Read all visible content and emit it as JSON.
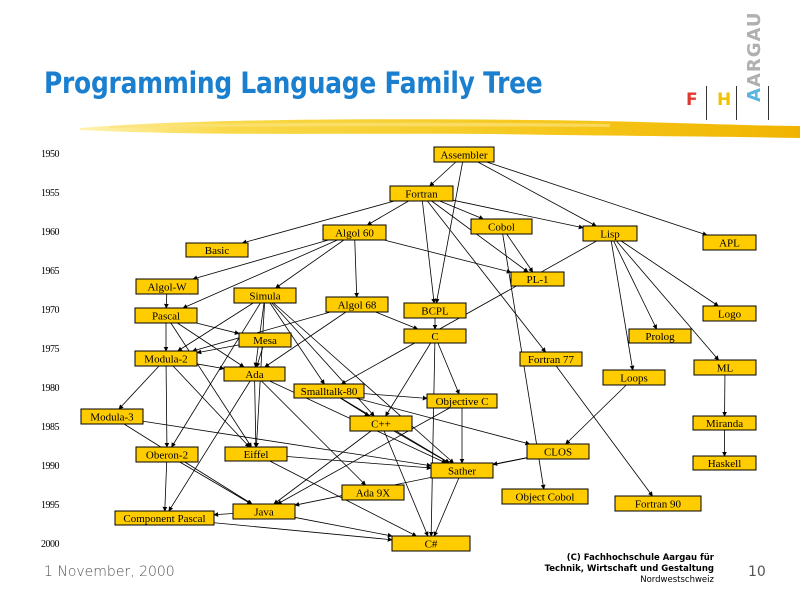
{
  "header": {
    "title": "Programming Language Family Tree",
    "logo": {
      "f": "F",
      "h": "H",
      "a_first": "A",
      "a_rest": "ARGAU"
    }
  },
  "colors": {
    "title": "#1a7fcf",
    "node_fill": "#ffcc00",
    "logo_f": "#e03a30",
    "logo_h": "#f2c200",
    "logo_a": "#5ab4e0"
  },
  "timeline": {
    "years": [
      "1950",
      "1955",
      "1960",
      "1965",
      "1970",
      "1975",
      "1980",
      "1985",
      "1990",
      "1995",
      "2000"
    ]
  },
  "diagram": {
    "nodes": [
      {
        "id": "assembler",
        "label": "Assembler"
      },
      {
        "id": "fortran",
        "label": "Fortran"
      },
      {
        "id": "cobol",
        "label": "Cobol"
      },
      {
        "id": "algol60",
        "label": "Algol 60"
      },
      {
        "id": "lisp",
        "label": "Lisp"
      },
      {
        "id": "apl",
        "label": "APL"
      },
      {
        "id": "basic",
        "label": "Basic"
      },
      {
        "id": "pl1",
        "label": "PL-1"
      },
      {
        "id": "algolw",
        "label": "Algol-W"
      },
      {
        "id": "simula",
        "label": "Simula"
      },
      {
        "id": "algol68",
        "label": "Algol 68"
      },
      {
        "id": "pascal",
        "label": "Pascal"
      },
      {
        "id": "bcpl",
        "label": "BCPL"
      },
      {
        "id": "logo",
        "label": "Logo"
      },
      {
        "id": "mesa",
        "label": "Mesa"
      },
      {
        "id": "c",
        "label": "C"
      },
      {
        "id": "prolog",
        "label": "Prolog"
      },
      {
        "id": "modula2",
        "label": "Modula-2"
      },
      {
        "id": "fortran77",
        "label": "Fortran 77"
      },
      {
        "id": "ml",
        "label": "ML"
      },
      {
        "id": "ada",
        "label": "Ada"
      },
      {
        "id": "loops",
        "label": "Loops"
      },
      {
        "id": "smalltalk80",
        "label": "Smalltalk-80"
      },
      {
        "id": "objc",
        "label": "Objective C"
      },
      {
        "id": "modula3",
        "label": "Modula-3"
      },
      {
        "id": "cpp",
        "label": "C++"
      },
      {
        "id": "miranda",
        "label": "Miranda"
      },
      {
        "id": "clos",
        "label": "CLOS"
      },
      {
        "id": "oberon2",
        "label": "Oberon-2"
      },
      {
        "id": "eiffel",
        "label": "Eiffel"
      },
      {
        "id": "haskell",
        "label": "Haskell"
      },
      {
        "id": "sather",
        "label": "Sather"
      },
      {
        "id": "ada9x",
        "label": "Ada 9X"
      },
      {
        "id": "objcobol",
        "label": "Object Cobol"
      },
      {
        "id": "fortran90",
        "label": "Fortran 90"
      },
      {
        "id": "java",
        "label": "Java"
      },
      {
        "id": "cpascal",
        "label": "Component Pascal"
      },
      {
        "id": "csharp",
        "label": "C#"
      }
    ],
    "edges": [
      [
        "assembler",
        "fortran"
      ],
      [
        "assembler",
        "bcpl"
      ],
      [
        "assembler",
        "lisp"
      ],
      [
        "assembler",
        "apl"
      ],
      [
        "fortran",
        "algol60"
      ],
      [
        "fortran",
        "cobol"
      ],
      [
        "fortran",
        "lisp"
      ],
      [
        "fortran",
        "basic"
      ],
      [
        "fortran",
        "pl1"
      ],
      [
        "fortran",
        "bcpl"
      ],
      [
        "fortran",
        "fortran77"
      ],
      [
        "cobol",
        "pl1"
      ],
      [
        "cobol",
        "objcobol"
      ],
      [
        "algol60",
        "algolw"
      ],
      [
        "algol60",
        "simula"
      ],
      [
        "algol60",
        "algol68"
      ],
      [
        "algol60",
        "pl1"
      ],
      [
        "algol60",
        "pascal"
      ],
      [
        "algolw",
        "pascal"
      ],
      [
        "bcpl",
        "c"
      ],
      [
        "algol68",
        "c"
      ],
      [
        "algol68",
        "modula2"
      ],
      [
        "algol68",
        "ada"
      ],
      [
        "pascal",
        "modula2"
      ],
      [
        "pascal",
        "mesa"
      ],
      [
        "pascal",
        "ada"
      ],
      [
        "pascal",
        "eiffel"
      ],
      [
        "simula",
        "modula2"
      ],
      [
        "simula",
        "smalltalk80"
      ],
      [
        "simula",
        "ada"
      ],
      [
        "simula",
        "cpp"
      ],
      [
        "simula",
        "eiffel"
      ],
      [
        "simula",
        "oberon2"
      ],
      [
        "simula",
        "sather"
      ],
      [
        "mesa",
        "ada"
      ],
      [
        "mesa",
        "modula2"
      ],
      [
        "lisp",
        "logo"
      ],
      [
        "lisp",
        "prolog"
      ],
      [
        "lisp",
        "ml"
      ],
      [
        "lisp",
        "loops"
      ],
      [
        "lisp",
        "smalltalk80"
      ],
      [
        "ml",
        "miranda"
      ],
      [
        "miranda",
        "haskell"
      ],
      [
        "fortran77",
        "fortran90"
      ],
      [
        "c",
        "cpp"
      ],
      [
        "c",
        "objc"
      ],
      [
        "c",
        "csharp"
      ],
      [
        "modula2",
        "modula3"
      ],
      [
        "modula2",
        "oberon2"
      ],
      [
        "modula2",
        "ada"
      ],
      [
        "modula2",
        "eiffel"
      ],
      [
        "smalltalk80",
        "objc"
      ],
      [
        "smalltalk80",
        "cpp"
      ],
      [
        "smalltalk80",
        "clos"
      ],
      [
        "smalltalk80",
        "sather"
      ],
      [
        "loops",
        "clos"
      ],
      [
        "ada",
        "eiffel"
      ],
      [
        "ada",
        "ada9x"
      ],
      [
        "ada",
        "cpascal"
      ],
      [
        "ada",
        "sather"
      ],
      [
        "objc",
        "sather"
      ],
      [
        "objc",
        "java"
      ],
      [
        "cpp",
        "java"
      ],
      [
        "cpp",
        "sather"
      ],
      [
        "cpp",
        "csharp"
      ],
      [
        "clos",
        "sather"
      ],
      [
        "clos",
        "java"
      ],
      [
        "modula3",
        "sather"
      ],
      [
        "modula3",
        "java"
      ],
      [
        "oberon2",
        "cpascal"
      ],
      [
        "oberon2",
        "java"
      ],
      [
        "eiffel",
        "sather"
      ],
      [
        "eiffel",
        "csharp"
      ],
      [
        "sather",
        "csharp"
      ],
      [
        "java",
        "cpascal"
      ],
      [
        "java",
        "csharp"
      ],
      [
        "cpascal",
        "csharp"
      ]
    ]
  },
  "footer": {
    "date": "1 November, 2000",
    "org_line1": "(C) Fachhochschule Aargau für",
    "org_line2": "Technik, Wirtschaft und Gestaltung",
    "org_line3": "Nordwestschweiz",
    "page": "10"
  }
}
